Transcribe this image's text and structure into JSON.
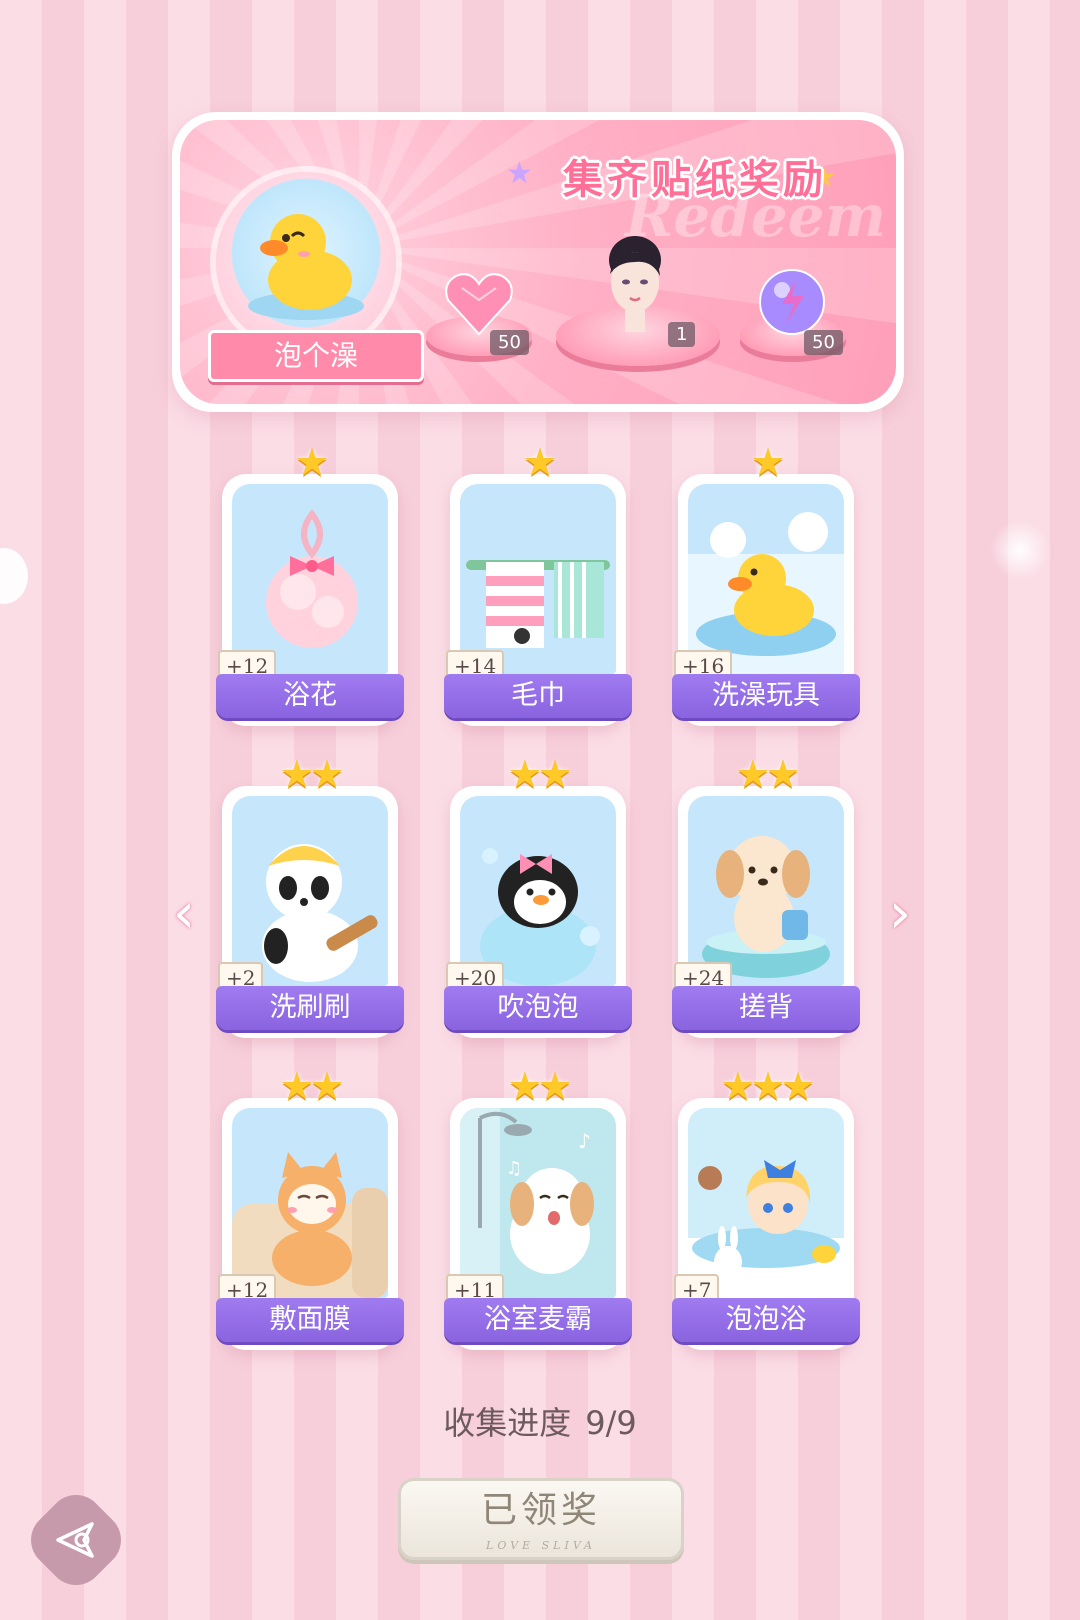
{
  "header": {
    "title": "集齐贴纸奖励",
    "watermark": "Redeem",
    "theme_label": "泡个澡",
    "rewards": [
      {
        "name": "heart-gem",
        "count": "50"
      },
      {
        "name": "avatar-portrait",
        "count": "1"
      },
      {
        "name": "energy-orb",
        "count": "50"
      }
    ]
  },
  "cards": [
    {
      "label": "浴花",
      "bonus": "+12",
      "stars": "★",
      "art": "bath-sponge"
    },
    {
      "label": "毛巾",
      "bonus": "+14",
      "stars": "★",
      "art": "towels"
    },
    {
      "label": "洗澡玩具",
      "bonus": "+16",
      "stars": "★",
      "art": "rubber-duck"
    },
    {
      "label": "洗刷刷",
      "bonus": "+2",
      "stars": "★★",
      "art": "panda-brush"
    },
    {
      "label": "吹泡泡",
      "bonus": "+20",
      "stars": "★★",
      "art": "penguin-bubble"
    },
    {
      "label": "搓背",
      "bonus": "+24",
      "stars": "★★",
      "art": "puppy-tub"
    },
    {
      "label": "敷面膜",
      "bonus": "+12",
      "stars": "★★",
      "art": "cat-mask"
    },
    {
      "label": "浴室麦霸",
      "bonus": "+11",
      "stars": "★★",
      "art": "dog-shower"
    },
    {
      "label": "泡泡浴",
      "bonus": "+7",
      "stars": "★★★",
      "art": "girl-bubblebath"
    }
  ],
  "progress": {
    "label": "收集进度",
    "value": "9/9"
  },
  "claim_button": {
    "label": "已领奖",
    "sub": "LOVE SLIVA"
  },
  "colors": {
    "accent_purple": "#8a63e0",
    "pink": "#ff9fb9",
    "star": "#ffc928"
  }
}
